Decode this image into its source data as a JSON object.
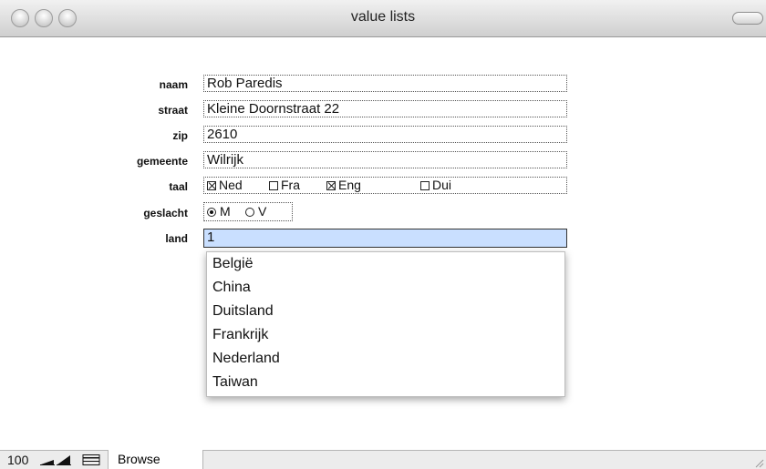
{
  "window": {
    "title": "value lists"
  },
  "form": {
    "naam": {
      "label": "naam",
      "value": "Rob Paredis"
    },
    "straat": {
      "label": "straat",
      "value": "Kleine Doornstraat 22"
    },
    "zip": {
      "label": "zip",
      "value": "2610"
    },
    "gemeente": {
      "label": "gemeente",
      "value": "Wilrijk"
    },
    "taal": {
      "label": "taal",
      "options": [
        {
          "label": "Ned",
          "checked": true
        },
        {
          "label": "Fra",
          "checked": false
        },
        {
          "label": "Eng",
          "checked": true
        },
        {
          "label": "Dui",
          "checked": false
        }
      ]
    },
    "geslacht": {
      "label": "geslacht",
      "options": [
        {
          "label": "M",
          "selected": true
        },
        {
          "label": "V",
          "selected": false
        }
      ]
    },
    "land": {
      "label": "land",
      "value": "1"
    }
  },
  "dropdown": {
    "items": [
      "België",
      "China",
      "Duitsland",
      "Frankrijk",
      "Nederland",
      "Taiwan"
    ]
  },
  "statusbar": {
    "zoom": "100",
    "mode": "Browse"
  }
}
